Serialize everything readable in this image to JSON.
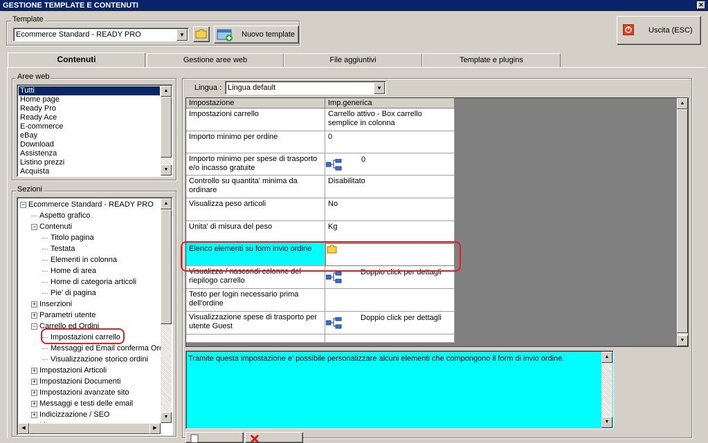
{
  "window": {
    "title": "GESTIONE TEMPLATE E CONTENUTI",
    "close_glyph": "✕"
  },
  "template": {
    "group_label": "Template",
    "selected": "Ecommerce Standard - READY PRO",
    "new_button": "Nuovo template"
  },
  "exit_button": "Uscita (ESC)",
  "tabs": [
    "Contenuti",
    "Gestione aree web",
    "File aggiuntivi",
    "Template e plugins"
  ],
  "aree_web": {
    "label": "Aree web",
    "items": [
      "Tutti",
      "Home page",
      "Ready Pro",
      "Ready Ace",
      "E-commerce",
      "eBay",
      "Download",
      "Assistenza",
      "Listino prezzi",
      "Acquista"
    ]
  },
  "sezioni": {
    "label": "Sezioni",
    "tree": [
      {
        "text": "Ecommerce Standard - READY PRO",
        "level": 0,
        "exp": "minus"
      },
      {
        "text": "Aspetto grafico",
        "level": 1,
        "exp": ""
      },
      {
        "text": "Contenuti",
        "level": 1,
        "exp": "minus"
      },
      {
        "text": "Titolo pagina",
        "level": 2,
        "exp": ""
      },
      {
        "text": "Testata",
        "level": 2,
        "exp": ""
      },
      {
        "text": "Elementi in colonna",
        "level": 2,
        "exp": ""
      },
      {
        "text": "Home di area",
        "level": 2,
        "exp": ""
      },
      {
        "text": "Home di categoria articoli",
        "level": 2,
        "exp": ""
      },
      {
        "text": "Pie' di pagina",
        "level": 2,
        "exp": ""
      },
      {
        "text": "Inserzioni",
        "level": 1,
        "exp": "plus"
      },
      {
        "text": "Parametri utente",
        "level": 1,
        "exp": "plus"
      },
      {
        "text": "Carrello ed Ordini",
        "level": 1,
        "exp": "minus"
      },
      {
        "text": "Impostazioni carrello",
        "level": 2,
        "exp": ""
      },
      {
        "text": "Messaggi ed Email conferma Ordini",
        "level": 2,
        "exp": ""
      },
      {
        "text": "Visualizzazione storico ordini",
        "level": 2,
        "exp": ""
      },
      {
        "text": "Impostazioni Articoli",
        "level": 1,
        "exp": "plus"
      },
      {
        "text": "Impostazioni Documenti",
        "level": 1,
        "exp": "plus"
      },
      {
        "text": "Impostazioni avanzate sito",
        "level": 1,
        "exp": "plus"
      },
      {
        "text": "Messaggi e testi delle email",
        "level": 1,
        "exp": "plus"
      },
      {
        "text": "Indicizzazione / SEO",
        "level": 1,
        "exp": "plus"
      },
      {
        "text": "Lingue",
        "level": 1,
        "exp": "plus"
      }
    ]
  },
  "lingua": {
    "label": "Lingua :",
    "selected": "Lingua default"
  },
  "grid": {
    "headers": [
      "Impostazione",
      "Imp.generica"
    ],
    "rows": [
      {
        "name": "Impostazioni carrello",
        "value": "Carrello attivo - Box carrello semplice in colonna",
        "icon": false
      },
      {
        "name": "Importo minimo per ordine",
        "value": "0",
        "icon": false
      },
      {
        "name": "Importo minimo per spese di trasporto e/o incasso gratuite",
        "value": "0",
        "icon": true
      },
      {
        "name": "Controllo su quantita' minima da ordinare",
        "value": "Disabilitato",
        "icon": false
      },
      {
        "name": "Visualizza peso articoli",
        "value": "No",
        "icon": false
      },
      {
        "name": "Unita' di misura del peso",
        "value": "Kg",
        "icon": false
      },
      {
        "name": "Elenco elementi su form invio ordine",
        "value": "",
        "icon": false
      },
      {
        "name": "Visualizza / nascondi colonne del riepilogo carrello",
        "value": "Doppio click per dettagli",
        "icon": true
      },
      {
        "name": "Testo per login necessario prima dell'ordine",
        "value": "",
        "icon": false
      },
      {
        "name": "Visualizzazione spese di trasporto per utente Guest",
        "value": "Doppio click per dettagli",
        "icon": true
      },
      {
        "name": "",
        "value": "",
        "icon": false
      }
    ]
  },
  "description": "Tramite questa impostazione e' possibile personalizzare alcuni elementi che compongono il form di invio ordine.",
  "colors": {
    "highlight": "#00ffff",
    "selection": "#0a246a",
    "annotation": "#e0202a"
  }
}
